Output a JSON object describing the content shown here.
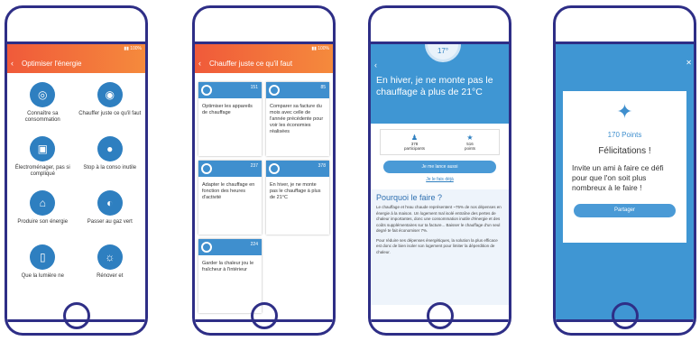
{
  "screen1": {
    "title": "Optimiser l'énergie",
    "items": [
      {
        "label": "Connaître sa consommation",
        "icon": "meter-icon"
      },
      {
        "label": "Chauffer juste ce qu'il faut",
        "icon": "thermostat-icon"
      },
      {
        "label": "Électroménager, pas si compliqué",
        "icon": "washing-machine-icon"
      },
      {
        "label": "Stop à la conso inutile",
        "icon": "piggy-bank-icon"
      },
      {
        "label": "Produire son énergie",
        "icon": "solar-icon"
      },
      {
        "label": "Passer au gaz vert",
        "icon": "gas-icon"
      },
      {
        "label": "Que la lumière ne",
        "icon": "light-switch-icon"
      },
      {
        "label": "Rénover et",
        "icon": "bulb-icon"
      }
    ]
  },
  "screen2": {
    "title": "Chauffer juste ce qu'il faut",
    "cards": [
      {
        "count": "151",
        "text": "Optimiser les appareils de chauffage"
      },
      {
        "count": "85",
        "text": "Comparer sa facture du mois avec celle de l'année précédente pour voir les économies réalisées"
      },
      {
        "count": "237",
        "text": "Adapter le chauffage en fonction des heures d'activité"
      },
      {
        "count": "378",
        "text": "En hiver, je ne monte pas le chauffage à plus de 21°C"
      },
      {
        "count": "224",
        "text": "Garder la chaleur jou le fraîcheur à l'intérieur"
      }
    ]
  },
  "screen3": {
    "temp": "17°",
    "title": "En hiver, je ne monte pas le chauffage à plus de 21°C",
    "participants_value": "378",
    "participants_label": "participants",
    "points_value": "516",
    "points_label": "points",
    "cta": "Je me lance aussi",
    "done_link": "Je le fais déjà",
    "why_title": "Pourquoi le faire ?",
    "why_p1": "Le chauffage et l'eau chaude représentent ~75% de nos dépenses en énergie à la maison. Un logement mal isolé entraîne des pertes de chaleur importantes, donc une consommation inutile d'énergie et des coûts supplémentaires sur ta facture... Baisser le chauffage d'un seul degré te fait économiser 7%.",
    "why_p2": "Pour réduire ses dépenses énergétiques, la solution la plus efficace est donc de bien isoler son logement pour limiter la déperdition de chaleur."
  },
  "screen4": {
    "points": "170 Points",
    "congrats": "Félicitations !",
    "invite": "Invite un ami à faire ce défi pour que l'on soit plus nombreux à le faire !",
    "share": "Partager"
  }
}
